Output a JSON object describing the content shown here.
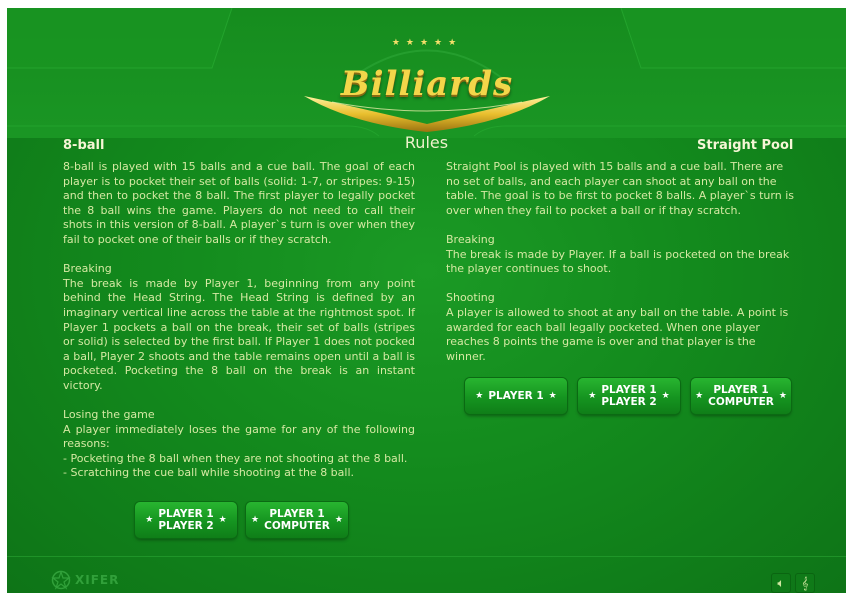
{
  "logo": {
    "title": "Billiards",
    "stars": "★★★★★"
  },
  "rules_title": "Rules",
  "eight_ball": {
    "heading": "8-ball",
    "intro": "8-ball is played with 15 balls and a cue ball. The goal of each player is to pocket their set of balls (solid: 1-7, or stripes: 9-15) and then to pocket the 8 ball. The first player to legally pocket the 8 ball wins the game. Players do not need to call their shots in this version of 8-ball. A player`s turn is over when they fail to pocket one of their balls or if they scratch.",
    "breaking_title": "Breaking",
    "breaking_text": "The break is made by Player 1, beginning from any point behind the Head String. The Head String is defined by an imaginary vertical line across the table at the rightmost spot. If Player 1 pockets a ball on the break, their set of balls (stripes or solid) is selected by the first ball. If Player 1 does not pocked a ball, Player 2 shoots and the table remains open until a ball is pocketed. Pocketing the 8 ball on the break is an instant victory.",
    "losing_title": "Losing the game",
    "losing_text": "A player immediately loses the game for any of the following reasons:",
    "losing_items": [
      "- Pocketing the 8 ball when they are not shooting at the 8 ball.",
      "- Scratching the cue ball while shooting at the 8 ball."
    ],
    "buttons": [
      "PLAYER 1\nPLAYER 2",
      "PLAYER 1\nCOMPUTER"
    ]
  },
  "straight_pool": {
    "heading": "Straight Pool",
    "intro": "Straight Pool is played with 15 balls and a cue ball. There are no set of balls, and each player can shoot at any ball on the table. The goal is to be first to pocket 8 balls. A player`s turn is over when they fail to pocket a ball or if thay scratch.",
    "breaking_title": "Breaking",
    "breaking_text": "The break is made by Player. If a ball is pocketed on the break the player continues to shoot.",
    "shooting_title": "Shooting",
    "shooting_text": "A player is allowed to shoot at any ball on the table. A point is awarded for each ball legally pocketed. When one player reaches 8 points the game is over and that player is the winner.",
    "buttons": [
      "PLAYER 1",
      "PLAYER 1\nPLAYER 2",
      "PLAYER 1\nCOMPUTER"
    ]
  },
  "footer": {
    "brand": "XIFER",
    "sound_icon": "speaker-icon",
    "music_icon": "music-note-icon"
  },
  "colors": {
    "background": "#138a1d",
    "text": "#d5e9a3",
    "heading": "#f6f6d6",
    "logo_gold": "#f3d64a"
  }
}
